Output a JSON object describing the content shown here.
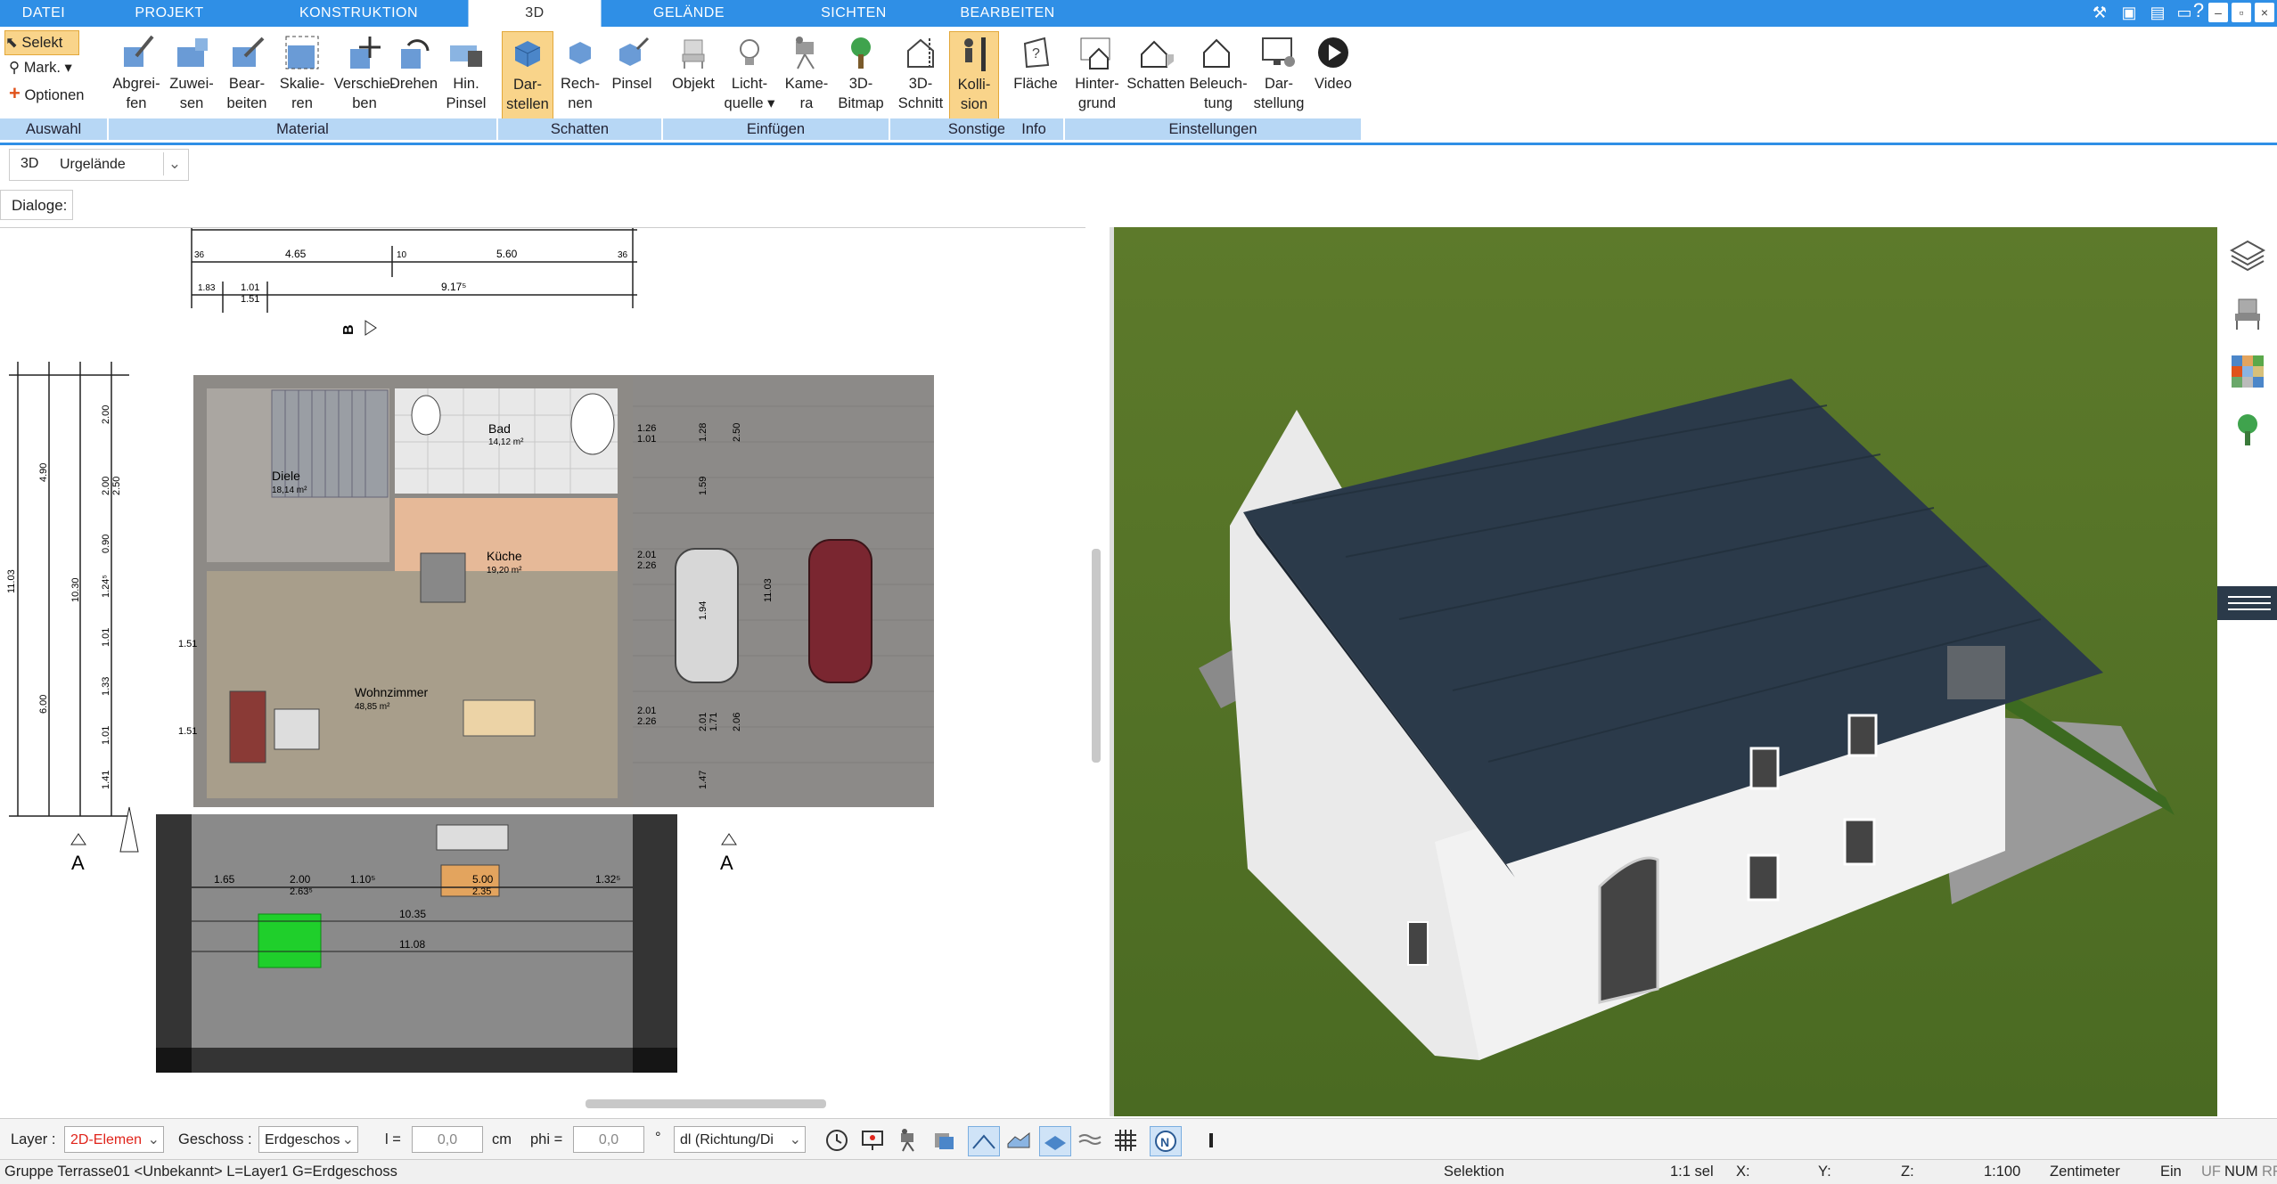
{
  "menu": {
    "tabs": [
      "DATEI",
      "PROJEKT",
      "KONSTRUKTION",
      "3D",
      "GELÄNDE",
      "SICHTEN",
      "BEARBEITEN"
    ],
    "active_tab": "3D"
  },
  "ribbon": {
    "auswahl": {
      "select": "Selekt",
      "mark": "Mark.",
      "options": "Optionen",
      "group": "Auswahl"
    },
    "material": {
      "buttons": [
        {
          "l1": "Abgrei-",
          "l2": "fen"
        },
        {
          "l1": "Zuwei-",
          "l2": "sen"
        },
        {
          "l1": "Bear-",
          "l2": "beiten"
        },
        {
          "l1": "Skalie-",
          "l2": "ren"
        },
        {
          "l1": "Verschie-",
          "l2": "ben"
        },
        {
          "l1": "Drehen",
          "l2": ""
        },
        {
          "l1": "Hin.",
          "l2": "Pinsel"
        }
      ],
      "group": "Material"
    },
    "schatten": {
      "buttons": [
        {
          "l1": "Dar-",
          "l2": "stellen"
        },
        {
          "l1": "Rech-",
          "l2": "nen"
        },
        {
          "l1": "Pinsel",
          "l2": ""
        }
      ],
      "group": "Schatten"
    },
    "einfuegen": {
      "buttons": [
        {
          "l1": "Objekt",
          "l2": ""
        },
        {
          "l1": "Licht-",
          "l2": "quelle ▾"
        },
        {
          "l1": "Kame-",
          "l2": "ra"
        },
        {
          "l1": "3D-",
          "l2": "Bitmap"
        }
      ],
      "group": "Einfügen"
    },
    "sonstige": {
      "buttons": [
        {
          "l1": "3D-",
          "l2": "Schnitt"
        },
        {
          "l1": "Kolli-",
          "l2": "sion"
        }
      ],
      "group": "Sonstige"
    },
    "info": {
      "buttons": [
        {
          "l1": "Fläche",
          "l2": ""
        }
      ],
      "group": "Info"
    },
    "einstellungen": {
      "buttons": [
        {
          "l1": "Hinter-",
          "l2": "grund"
        },
        {
          "l1": "Schatten",
          "l2": ""
        },
        {
          "l1": "Beleuch-",
          "l2": "tung"
        },
        {
          "l1": "Dar-",
          "l2": "stellung"
        },
        {
          "l1": "Video",
          "l2": ""
        }
      ],
      "group": "Einstellungen"
    }
  },
  "toolbar": {
    "mode": "3D",
    "terrain": "Urgelände",
    "dialogs_label": "Dialoge:"
  },
  "plan": {
    "dims_top": [
      "4.65",
      "5.60",
      "9.17⁵",
      "1.01",
      "1.51",
      "36",
      "10",
      "36",
      "1.83"
    ],
    "section_b": "B",
    "section_a": "A",
    "rooms": [
      {
        "name": "Diele",
        "area": "18,14 m²"
      },
      {
        "name": "Bad",
        "area": "14,12 m²"
      },
      {
        "name": "Küche",
        "area": "19,20 m²"
      },
      {
        "name": "Wohnzimmer",
        "area": "48,85 m²"
      }
    ],
    "dims_left": [
      "11.03",
      "4.90",
      "10.30",
      "6.00",
      "2.00",
      "2.00",
      "0.90",
      "1.24⁵",
      "1.01",
      "1.33",
      "1.01",
      "1.41",
      "2.50",
      "1.51",
      "1.51"
    ],
    "dims_terrace": [
      "1.65",
      "2.00",
      "2.63⁵",
      "1.10⁵",
      "5.00",
      "2.35",
      "1.32⁵",
      "10.35",
      "11.08"
    ],
    "dims_garage": [
      "1.26",
      "1.01",
      "2.01",
      "2.26",
      "2.01",
      "2.26",
      "1.28",
      "2.50",
      "1.59",
      "1.94",
      "2.01",
      "1.71",
      "2.06",
      "11.03",
      "1.47"
    ]
  },
  "bottombar": {
    "layer_label": "Layer :",
    "layer_value": "2D-Elemen",
    "geschoss_label": "Geschoss :",
    "geschoss_value": "Erdgeschos",
    "l_label": "l =",
    "l_value": "0,0",
    "l_unit": "cm",
    "phi_label": "phi =",
    "phi_value": "0,0",
    "phi_unit": "°",
    "direction_value": "dl (Richtung/Di"
  },
  "status": {
    "left": "Gruppe Terrasse01 <Unbekannt> L=Layer1 G=Erdgeschoss",
    "mode": "Selektion",
    "sel": "1:1 sel",
    "x": "X:",
    "y": "Y:",
    "z": "Z:",
    "scale": "1:100",
    "unit": "Zentimeter",
    "ein": "Ein",
    "uf": "UF",
    "num": "NUM",
    "rf": "RF"
  },
  "colors": {
    "accent": "#2f8fe6",
    "group_bg": "#b7d7f5",
    "selected": "#f9d48a",
    "lawn": "#5a7a2e",
    "roof": "#2b3a4a",
    "wall": "#f1f1f1"
  }
}
